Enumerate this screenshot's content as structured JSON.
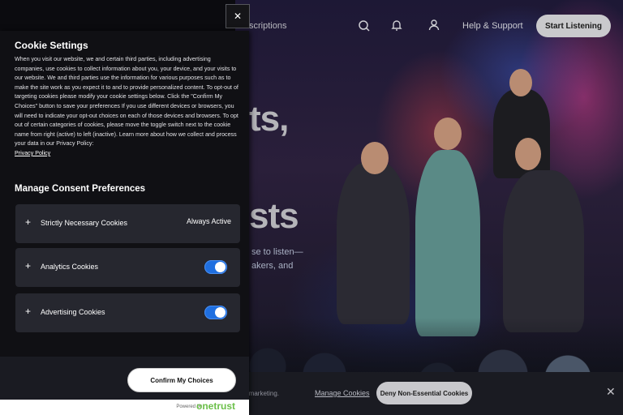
{
  "background_page": {
    "nav_partial": "scriptions",
    "help_label": "Help & Support",
    "start_label": "Start Listening",
    "hero_line1": "ts,",
    "hero_line2": "sts",
    "hero_sub1": "se to listen—",
    "hero_sub2": "akers, and",
    "icons": [
      "search-icon",
      "bell-icon",
      "user-icon"
    ]
  },
  "banner": {
    "text_partial": "d marketing.",
    "manage_label": "Manage Cookies",
    "deny_label": "Deny Non-Essential Cookies",
    "close_glyph": "✕"
  },
  "modal": {
    "close_glyph": "✕",
    "title": "Cookie Settings",
    "description": "When you visit our website, we and certain third parties, including advertising companies, use cookies to collect information about you, your device, and your visits to our website. We and third parties use the information for various purposes such as to make the site work as you expect it to and to provide personalized content. To opt-out of targeting cookies please modify your cookie settings below. Click the \"Confirm My Choices\" button to save your preferences If you use different devices or browsers, you will need to indicate your opt-out choices on each of those devices and browsers. To opt out of certain categories of cookies, please move the toggle switch next to the cookie name from right (active) to left (inactive). Learn more about how we collect and process your data in our Privacy Policy:",
    "policy_link": "Privacy Policy",
    "manage_title": "Manage Consent Preferences",
    "preferences": [
      {
        "label": "Strictly Necessary Cookies",
        "status": "Always Active"
      },
      {
        "label": "Analytics Cookies",
        "enabled": true
      },
      {
        "label": "Advertising Cookies",
        "enabled": true
      }
    ],
    "confirm_label": "Confirm My Choices",
    "powered_by": "Powered by",
    "powered_brand": "onetrust"
  },
  "colors": {
    "toggle_on": "#1f6fe0",
    "onetrust_green": "#6cc04a"
  }
}
